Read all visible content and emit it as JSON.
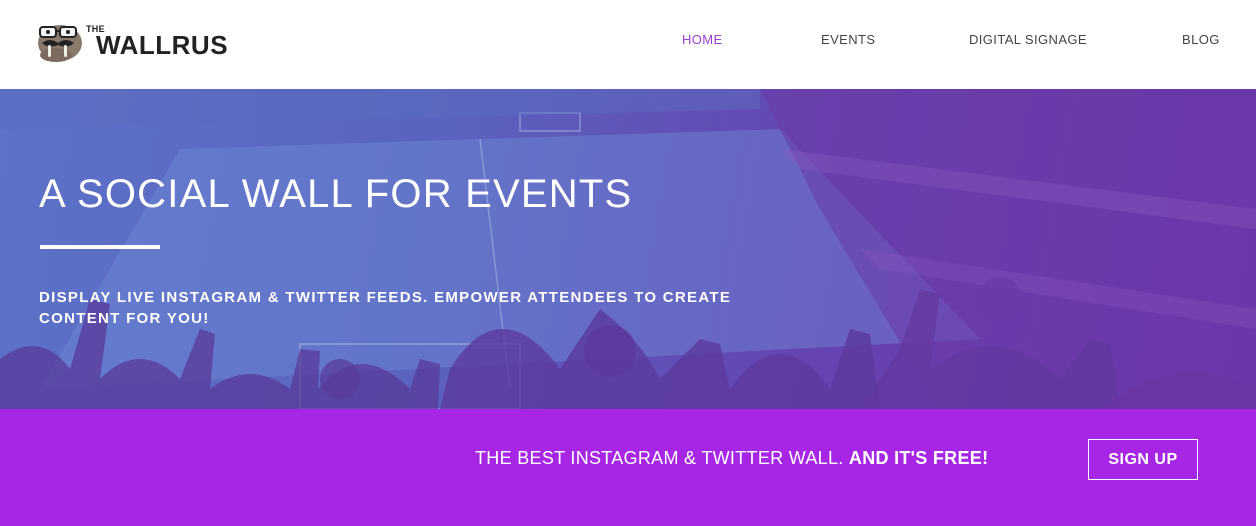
{
  "header": {
    "logo": {
      "small_text": "THE",
      "main_text": "WALLRUS",
      "icon": "walrus-mascot-icon"
    },
    "nav": [
      {
        "label": "HOME",
        "active": true
      },
      {
        "label": "EVENTS",
        "active": false
      },
      {
        "label": "DIGITAL SIGNAGE",
        "active": false
      },
      {
        "label": "BLOG",
        "active": false
      }
    ]
  },
  "hero": {
    "title": "A SOCIAL WALL FOR EVENTS",
    "subtitle": "DISPLAY LIVE INSTAGRAM & TWITTER FEEDS. EMPOWER ATTENDEES TO CREATE CONTENT FOR YOU!"
  },
  "cta": {
    "text_regular": "THE BEST INSTAGRAM & TWITTER WALL.",
    "text_bold": "AND IT'S FREE!",
    "button_label": "SIGN UP"
  },
  "colors": {
    "accent": "#9b3fd0",
    "cta_bar": "#a726e6",
    "hero_overlay_left": "#5d72c8",
    "hero_overlay_right": "#6a33a8"
  }
}
